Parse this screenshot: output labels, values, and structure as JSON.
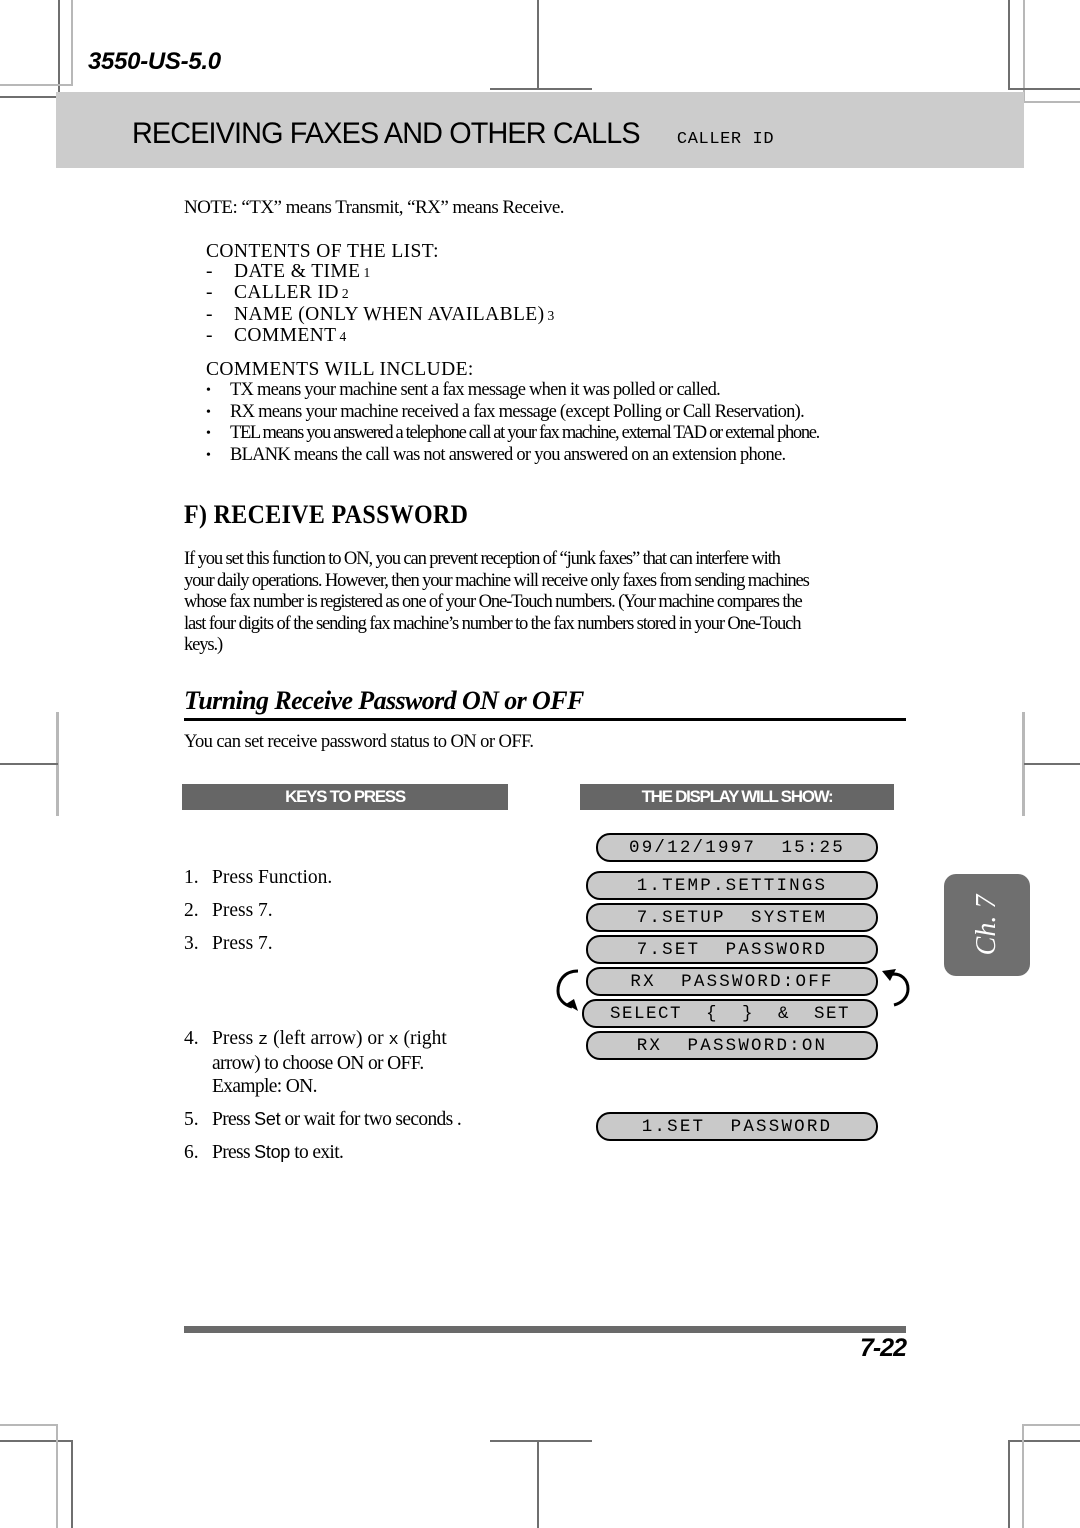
{
  "page": {
    "doc_code": "3550-US-5.0",
    "footer_page_number": "7-22",
    "chapter_tab": "Ch. 7"
  },
  "header": {
    "title": "RECEIVING FAXES AND OTHER CALLS",
    "subtitle": "CALLER ID"
  },
  "note": {
    "text": "NOTE: “TX” means Transmit, “RX” means Receive."
  },
  "contents": {
    "heading": "CONTENTS OF THE LIST:",
    "items": [
      {
        "dash": "-",
        "label": "DATE & TIME",
        "num": "1"
      },
      {
        "dash": "-",
        "label": "CALLER  ID",
        "num": "2"
      },
      {
        "dash": "-",
        "label": "NAME (ONLY WHEN AVAILABLE)",
        "num": "3"
      },
      {
        "dash": "-",
        "label": "COMMENT",
        "num": "4"
      }
    ]
  },
  "comments": {
    "heading": "COMMENTS WILL INCLUDE:",
    "bullet": "•",
    "items": [
      "TX means your machine sent a fax message when it was polled or called.",
      "RX means your machine received a fax message (except Polling or Call Reservation).",
      "TEL means you answered a telephone call at your fax machine, external TAD or external phone.",
      "BLANK means the call was not answered or you answered on an extension phone."
    ]
  },
  "section": {
    "heading": "F) RECEIVE PASSWORD",
    "paragraph_lines": [
      "If you set this function to ON, you can prevent reception of “junk faxes” that can interfere with",
      "your daily operations. However, then your machine will receive only faxes from sending machines",
      "whose fax number is registered as one of your One-Touch numbers. (Your machine compares the",
      "last four digits of the sending fax machine’s number to the fax numbers stored in your One-Touch",
      "keys.)"
    ]
  },
  "subsection": {
    "heading": "Turning Receive Password ON or OFF",
    "intro": "You can set receive password status to ON or OFF."
  },
  "table": {
    "col_keys_header": "KEYS TO PRESS",
    "col_display_header": "THE DISPLAY WILL SHOW:"
  },
  "steps": [
    {
      "num": "1.",
      "lines": [
        "Press  Function."
      ]
    },
    {
      "num": "2.",
      "lines": [
        "Press 7."
      ]
    },
    {
      "num": "3.",
      "lines": [
        "Press 7."
      ]
    },
    {
      "num": "4.",
      "lines": [
        "Press z (left arrow) or x (right",
        "arrow) to choose ON or OFF.",
        "Example: ON."
      ]
    },
    {
      "num": "5.",
      "lines": [
        "Press Set or wait for two seconds."
      ]
    },
    {
      "num": "6.",
      "lines": [
        "Press Stop to exit."
      ]
    }
  ],
  "step4_parts": {
    "press": "Press",
    "key_left": "z",
    "left_desc": "(left arrow) or",
    "key_right": "x",
    "right_desc": "(right",
    "line2": "arrow) to choose ON or OFF.",
    "line3": "Example: ON."
  },
  "step5_parts": {
    "a": "Press ",
    "set": "Set",
    "b": " or wait for two seconds ."
  },
  "step6_parts": {
    "a": "Press ",
    "stop": "Stop",
    "b": " to exit."
  },
  "displays": [
    {
      "text": "09/12/1997  15:25"
    },
    {
      "text": "1.TEMP.SETTINGS"
    },
    {
      "text": "7.SETUP  SYSTEM"
    },
    {
      "text": "7.SET  PASSWORD"
    },
    {
      "text": "RX  PASSWORD:OFF"
    },
    {
      "text": "SELECT  {  }  &  SET"
    },
    {
      "text": "RX  PASSWORD:ON"
    },
    {
      "text": "1.SET  PASSWORD"
    }
  ],
  "colors": {
    "header_band": "#cccccc",
    "column_header_bar": "#666666",
    "lcd_fill": "#c9c9c9",
    "chapter_tab": "#6f6f6f",
    "footer_rule": "#6a6a6a"
  }
}
